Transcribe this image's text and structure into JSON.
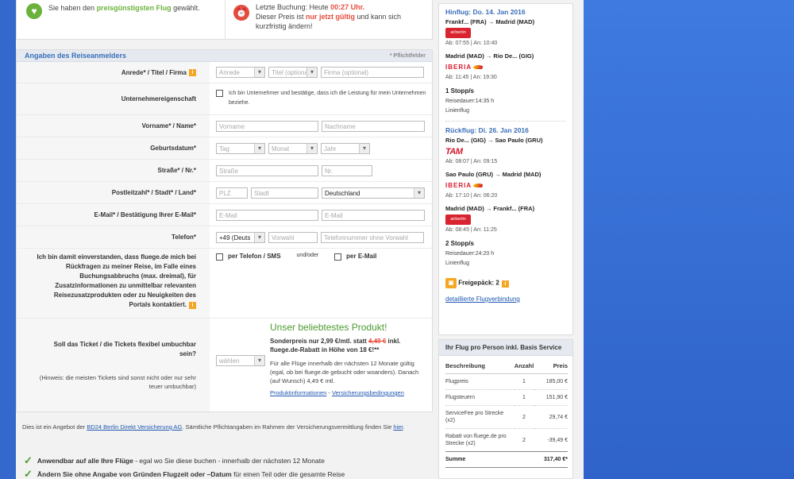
{
  "info": {
    "left_text_1": "Sie haben den ",
    "left_bold": "preisgünstigsten Flug",
    "left_text_2": " gewählt.",
    "right_line1_a": "Letzte Buchung: Heute ",
    "right_time": "00:27 Uhr.",
    "right_line2_a": "Dieser Preis ist ",
    "right_bold": "nur jetzt gültig",
    "right_line2_b": " und kann sich kurzfristig ändern!"
  },
  "form": {
    "title": "Angaben des Reiseanmelders",
    "required_note": "* Pflichtfelder",
    "anrede_label": "Anrede* / Titel / Firma",
    "anrede_ph": "Anrede",
    "titel_ph": "Titel (optional)",
    "firma_ph": "Firma (optional)",
    "unternehmer_label": "Unternehmereigenschaft",
    "unternehmer_text": "Ich bin Unternehmer und bestätige, dass ich die Leistung für mein Unternehmen beziehe.",
    "name_label": "Vorname* / Name*",
    "vorname_ph": "Vorname",
    "nachname_ph": "Nachname",
    "geburt_label": "Geburtsdatum*",
    "tag_ph": "Tag",
    "monat_ph": "Monat",
    "jahr_ph": "Jahr",
    "strasse_label": "Straße* / Nr.*",
    "strasse_ph": "Straße",
    "nr_ph": "Nr.",
    "plz_label": "Postleitzahl* / Stadt* / Land*",
    "plz_ph": "PLZ",
    "stadt_ph": "Stadt",
    "land_value": "Deutschland",
    "email_label": "E-Mail* / Bestätigung Ihrer E-Mail*",
    "email_ph": "E-Mail",
    "email2_ph": "E-Mail",
    "telefon_label": "Telefon*",
    "telefon_code": "+49 (Deuts",
    "vorwahl_ph": "Vorwahl",
    "telnr_ph": "Telefonnummer ohne Vorwahl",
    "consent_label": "Ich bin damit einverstanden, dass fluege.de mich bei Rückfragen zu meiner Reise, im Falle eines Buchungsabbruchs (max. dreimal), für Zusatzinformationen zu unmittelbar relevanten Reisezusatzprodukten oder zu Neuigkeiten des Portals kontaktiert.",
    "consent_phone": "per Telefon / SMS",
    "consent_or": "und/oder",
    "consent_email": "per E-Mail",
    "flex_label": "Soll das Ticket / die Tickets flexibel umbuchbar sein?",
    "flex_hint": "(Hinweis: die meisten Tickets sind sonst nicht oder nur sehr teuer umbuchbar)",
    "flex_select": "wählen",
    "product_title": "Unser beliebtestes Produkt!",
    "product_price_a": "Sonderpreis nur 2,99 €/mtl. statt ",
    "product_price_old": "4,49 €",
    "product_price_b": " inkl. fluege.de-Rabatt in Höhe von 18 €!**",
    "product_desc": "Für alle Flüge innerhalb der nächsten 12 Monate gültig (egal, ob bei fluege.de gebucht oder woanders). Danach (auf Wunsch) 4,49 € mtl.",
    "product_link1": "Produktinformationen",
    "product_link_sep": " - ",
    "product_link2": "Versicherungsbedingungen"
  },
  "disclaimer": {
    "text_a": "Dies ist ein Angebot der ",
    "link": "BD24 Berlin Direkt Versicherung AG",
    "text_b": ". Sämtliche Pflichtangaben im Rahmen der Versicherungsvermittlung finden Sie ",
    "link2": "hier",
    "text_c": "."
  },
  "bullets": [
    {
      "bold": "Anwendbar auf alle Ihre Flüge",
      "text": " - egal wo Sie diese buchen - innerhalb der nächsten 12 Monate"
    },
    {
      "bold": "Ändern Sie ohne Angabe von Gründen Flugzeit oder –Datum",
      "text": " für einen Teil oder die gesamte Reise"
    }
  ],
  "itinerary": {
    "outbound_head": "Hinflug: Do. 14. Jan 2016",
    "out_seg1_route": "Frankf... (FRA) → Madrid (MAD)",
    "out_seg1_airline": "airberlin",
    "out_seg1_times": "Ab: 07:55 | An: 10:40",
    "out_seg2_route": "Madrid (MAD) → Rio De... (GIG)",
    "out_seg2_airline": "IBERIA",
    "out_seg2_times": "Ab: 11:45 | An: 19:30",
    "out_stops": "1 Stopp/s",
    "out_duration": "Reisedauer:14:35 h",
    "out_type": "Linienflug",
    "return_head": "Rückflug: Di. 26. Jan 2016",
    "ret_seg1_route": "Rio De... (GIG) → Sao Paulo (GRU)",
    "ret_seg1_airline": "TAM",
    "ret_seg1_times": "Ab: 08:07 | An: 09:15",
    "ret_seg2_route": "Sao Paulo (GRU) → Madrid (MAD)",
    "ret_seg2_airline": "IBERIA",
    "ret_seg2_times": "Ab: 17:10 | An: 06:20",
    "ret_seg3_route": "Madrid (MAD) → Frankf... (FRA)",
    "ret_seg3_airline": "airberlin",
    "ret_seg3_times": "Ab: 08:45 | An: 11:25",
    "ret_stops": "2 Stopp/s",
    "ret_duration": "Reisedauer:24:20 h",
    "ret_type": "Linienflug",
    "baggage_label": "Freigepäck: 2",
    "details_link": "detaillierte Flugverbindung"
  },
  "price": {
    "title": "Ihr Flug pro Person inkl. Basis Service",
    "headers": [
      "Beschreibung",
      "Anzahl",
      "Preis"
    ],
    "rows": [
      [
        "Flugpreis",
        "1",
        "185,00 €"
      ],
      [
        "Flugsteuern",
        "1",
        "151,90 €"
      ],
      [
        "ServiceFee pro Strecke (x2)",
        "2",
        "29,74 €"
      ],
      [
        "Rabatt von fluege.de pro Strecke (x2)",
        "2",
        "-39,49 €"
      ]
    ],
    "sum_label": "Summe",
    "sum_value": "317,40 €*"
  }
}
